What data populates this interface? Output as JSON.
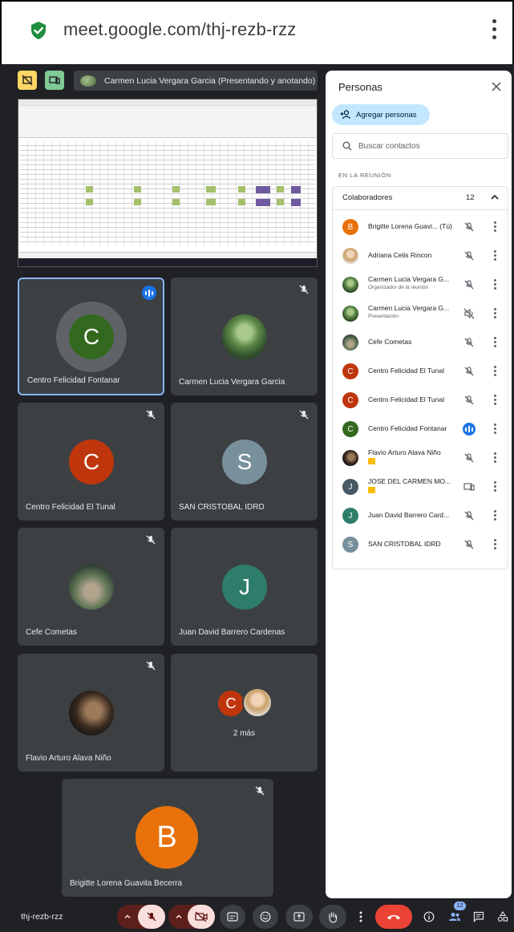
{
  "browser": {
    "url": "meet.google.com/thj-rezb-rzz"
  },
  "presenter_banner": {
    "text": "Carmen Lucia Vergara Garcia (Presentando y anotando)"
  },
  "tiles": [
    {
      "name": "Centro Felicidad Fontanar",
      "initial": "C",
      "color": "#33691e",
      "speaking": true
    },
    {
      "name": "Carmen Lucia Vergara Garcia",
      "photo": "park",
      "muted": true
    },
    {
      "name": "Centro Felicidad El Tunal",
      "initial": "C",
      "color": "#bf360c",
      "muted": true
    },
    {
      "name": "SAN CRISTOBAL IDRD",
      "initial": "S",
      "color": "#78909c",
      "muted": true
    },
    {
      "name": "Cefe Cometas",
      "photo": "hill",
      "muted": true
    },
    {
      "name": "Juan David Barrero Cardenas",
      "initial": "J",
      "color": "#2e7d6b",
      "muted": false
    },
    {
      "name": "Flavio Arturo Alava Niño",
      "photo": "man",
      "muted": true
    },
    {
      "more_label": "2 más",
      "initial": "C",
      "color": "#bf360c"
    },
    {
      "name": "Brigitte Lorena Guavita Becerra",
      "initial": "B",
      "color": "#e8710a",
      "muted": true
    }
  ],
  "panel": {
    "title": "Personas",
    "add_label": "Agregar personas",
    "search_placeholder": "Buscar contactos",
    "section_label": "EN LA REUNIÓN",
    "group_label": "Colaboradores",
    "group_count": "12",
    "people": [
      {
        "name": "Brigitte Lorena Guavi... (Tú)",
        "initial": "B",
        "color": "#e8710a",
        "icon": "mic-off-icon"
      },
      {
        "name": "Adriana Celis Rincon",
        "photo": "woman",
        "icon": "mic-off-icon"
      },
      {
        "name": "Carmen Lucia Vergara G...",
        "sub": "Organizador de la reunión",
        "photo": "park",
        "icon": "mic-off-icon"
      },
      {
        "name": "Carmen Lucia Vergara G...",
        "sub": "Presentación",
        "photo": "park",
        "icon": "volume-off-icon"
      },
      {
        "name": "Cefe Cometas",
        "photo": "hill",
        "icon": "mic-off-icon"
      },
      {
        "name": "Centro Felicidad El Tunal",
        "initial": "C",
        "color": "#bf360c",
        "icon": "mic-off-icon"
      },
      {
        "name": "Centro Felicidad El Tunal",
        "initial": "C",
        "color": "#bf360c",
        "icon": "mic-off-icon"
      },
      {
        "name": "Centro Felicidad Fontanar",
        "initial": "C",
        "color": "#33691e",
        "icon": "speaking-icon"
      },
      {
        "name": "Flavio Arturo Alava Niño",
        "photo": "man",
        "tag": true,
        "icon": "mic-off-icon"
      },
      {
        "name": "JOSE DEL CARMEN MO...",
        "initial": "J",
        "color": "#455a64",
        "tag": true,
        "icon": "present-icon"
      },
      {
        "name": "Juan David Barrero Card...",
        "initial": "J",
        "color": "#2e7d6b",
        "icon": "mic-off-icon"
      },
      {
        "name": "SAN CRISTOBAL IDRD",
        "initial": "S",
        "color": "#78909c",
        "icon": "mic-off-icon"
      }
    ]
  },
  "bottom_bar": {
    "meeting_code": "thj-rezb-rzz",
    "people_count": "12"
  }
}
